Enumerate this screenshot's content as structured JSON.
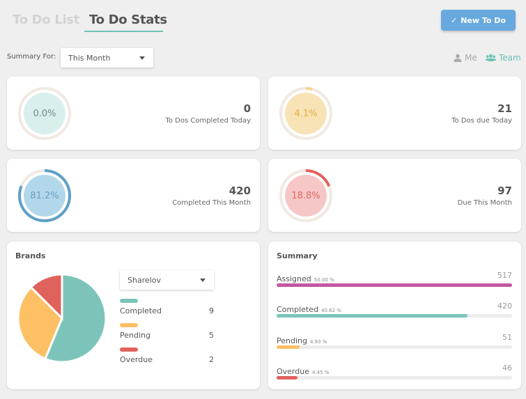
{
  "tabs": [
    {
      "label": "To Do List",
      "active": false
    },
    {
      "label": "To Do Stats",
      "active": true
    }
  ],
  "new_todo_button": {
    "icon": "check-icon",
    "glyph": "✓",
    "label": "New To Do"
  },
  "filter": {
    "label": "Summary For:",
    "selected": "This Month"
  },
  "scope": {
    "me": {
      "icon": "user-icon",
      "label": "Me",
      "active": false
    },
    "team": {
      "icon": "users-icon",
      "label": "Team",
      "active": true
    }
  },
  "colors": {
    "teal": "#6cc3b5",
    "blue": "#67a9de",
    "yellow": "#fdc065",
    "red": "#e0625c",
    "magenta": "#c457a1"
  },
  "stats": [
    {
      "percent": 0.0,
      "percent_label": "0.0%",
      "value": "0",
      "label": "To Dos Completed Today",
      "ring_color": "#6cc3b5",
      "inner_color": "#d9efee",
      "text_color": "#6b8a8a"
    },
    {
      "percent": 4.1,
      "percent_label": "4.1%",
      "value": "21",
      "label": "To Dos due Today",
      "ring_color": "#f7d58c",
      "inner_color": "#f8e3b6",
      "text_color": "#e8ac3e"
    },
    {
      "percent": 81.2,
      "percent_label": "81.2%",
      "value": "420",
      "label": "Completed This Month",
      "ring_color": "#5f9fc7",
      "inner_color": "#b3d7ea",
      "text_color": "#6a9fc3"
    },
    {
      "percent": 18.8,
      "percent_label": "18.8%",
      "value": "97",
      "label": "Due This Month",
      "ring_color": "#e0625c",
      "inner_color": "#f6c7c6",
      "text_color": "#de6b67"
    }
  ],
  "brands": {
    "title": "Brands",
    "selected": "Sharelov",
    "items": [
      {
        "label": "Completed",
        "value": 9,
        "color": "#7cc4ba"
      },
      {
        "label": "Pending",
        "value": 5,
        "color": "#fdc065"
      },
      {
        "label": "Overdue",
        "value": 2,
        "color": "#e0625c"
      }
    ]
  },
  "summary": {
    "title": "Summary",
    "rows": [
      {
        "label": "Assigned",
        "pct_label": "50.00 %",
        "value": "517",
        "fill": 1.0,
        "color": "#c457a1"
      },
      {
        "label": "Completed",
        "pct_label": "40.62 %",
        "value": "420",
        "fill": 0.812,
        "color": "#7cc4ba"
      },
      {
        "label": "Pending",
        "pct_label": "4.93 %",
        "value": "51",
        "fill": 0.099,
        "color": "#fdc065"
      },
      {
        "label": "Overdue",
        "pct_label": "4.45 %",
        "value": "46",
        "fill": 0.089,
        "color": "#e0625c"
      }
    ]
  }
}
